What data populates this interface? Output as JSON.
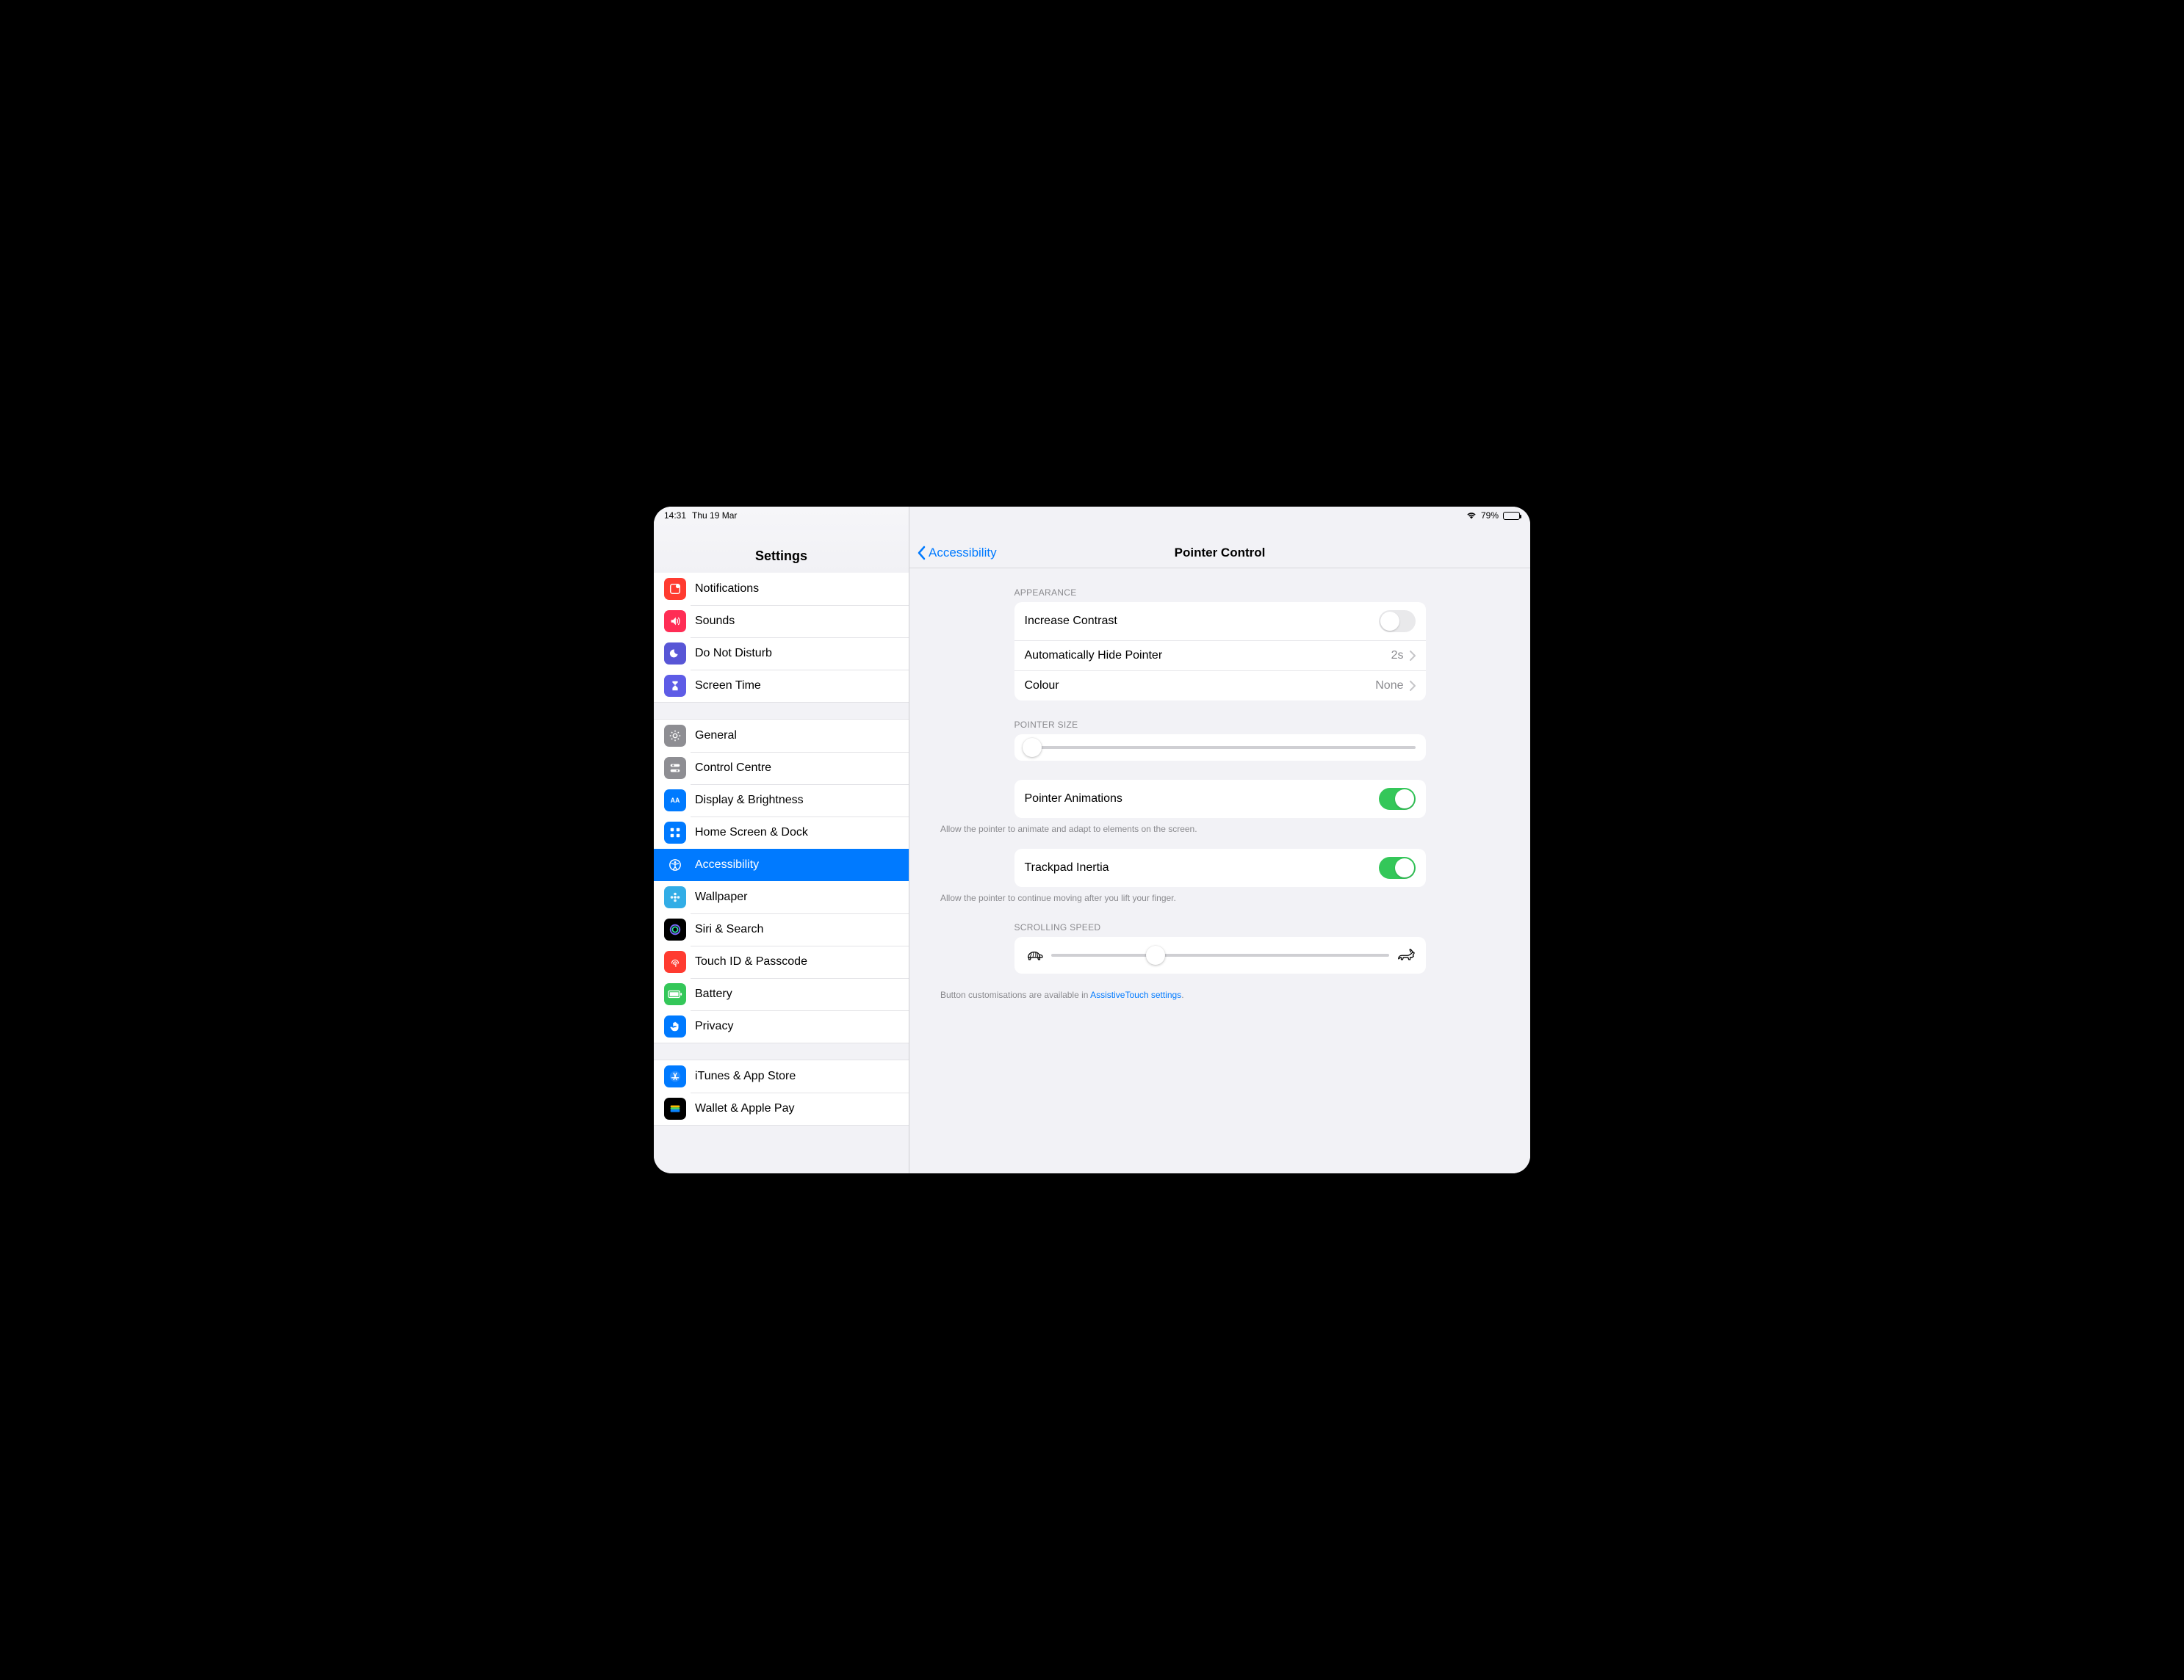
{
  "status": {
    "time": "14:31",
    "date": "Thu 19 Mar",
    "battery_pct": "79%"
  },
  "sidebar_title": "Settings",
  "sidebar": {
    "groups": [
      {
        "items": [
          {
            "label": "Notifications",
            "icon": "notifications-icon",
            "color": "bg-red"
          },
          {
            "label": "Sounds",
            "icon": "sounds-icon",
            "color": "bg-orred"
          },
          {
            "label": "Do Not Disturb",
            "icon": "moon-icon",
            "color": "bg-purple"
          },
          {
            "label": "Screen Time",
            "icon": "hourglass-icon",
            "color": "bg-indigo"
          }
        ]
      },
      {
        "items": [
          {
            "label": "General",
            "icon": "gear-icon",
            "color": "bg-grey"
          },
          {
            "label": "Control Centre",
            "icon": "switches-icon",
            "color": "bg-grey"
          },
          {
            "label": "Display & Brightness",
            "icon": "display-icon",
            "color": "bg-blue"
          },
          {
            "label": "Home Screen & Dock",
            "icon": "grid-icon",
            "color": "bg-blue"
          },
          {
            "label": "Accessibility",
            "icon": "accessibility-icon",
            "color": "bg-blue",
            "selected": true
          },
          {
            "label": "Wallpaper",
            "icon": "flower-icon",
            "color": "bg-teal"
          },
          {
            "label": "Siri & Search",
            "icon": "siri-icon",
            "color": "bg-black"
          },
          {
            "label": "Touch ID & Passcode",
            "icon": "fingerprint-icon",
            "color": "bg-red"
          },
          {
            "label": "Battery",
            "icon": "battery-icon",
            "color": "bg-green"
          },
          {
            "label": "Privacy",
            "icon": "hand-icon",
            "color": "bg-blue"
          }
        ]
      },
      {
        "items": [
          {
            "label": "iTunes & App Store",
            "icon": "appstore-icon",
            "color": "bg-blue"
          },
          {
            "label": "Wallet & Apple Pay",
            "icon": "wallet-icon",
            "color": "bg-black"
          }
        ]
      }
    ]
  },
  "detail": {
    "back_label": "Accessibility",
    "title": "Pointer Control",
    "sections": {
      "appearance_header": "APPEARANCE",
      "increase_contrast": {
        "label": "Increase Contrast",
        "on": false
      },
      "auto_hide": {
        "label": "Automatically Hide Pointer",
        "value": "2s"
      },
      "colour": {
        "label": "Colour",
        "value": "None"
      },
      "pointer_size_header": "POINTER SIZE",
      "pointer_size_value": 0.02,
      "pointer_animations": {
        "label": "Pointer Animations",
        "on": true
      },
      "pointer_animations_footer": "Allow the pointer to animate and adapt to elements on the screen.",
      "trackpad_inertia": {
        "label": "Trackpad Inertia",
        "on": true
      },
      "trackpad_inertia_footer": "Allow the pointer to continue moving after you lift your finger.",
      "scroll_header": "SCROLLING SPEED",
      "scroll_value": 0.31,
      "bottom_note_pre": "Button customisations are available in ",
      "bottom_note_link": "AssistiveTouch settings",
      "bottom_note_post": "."
    }
  }
}
